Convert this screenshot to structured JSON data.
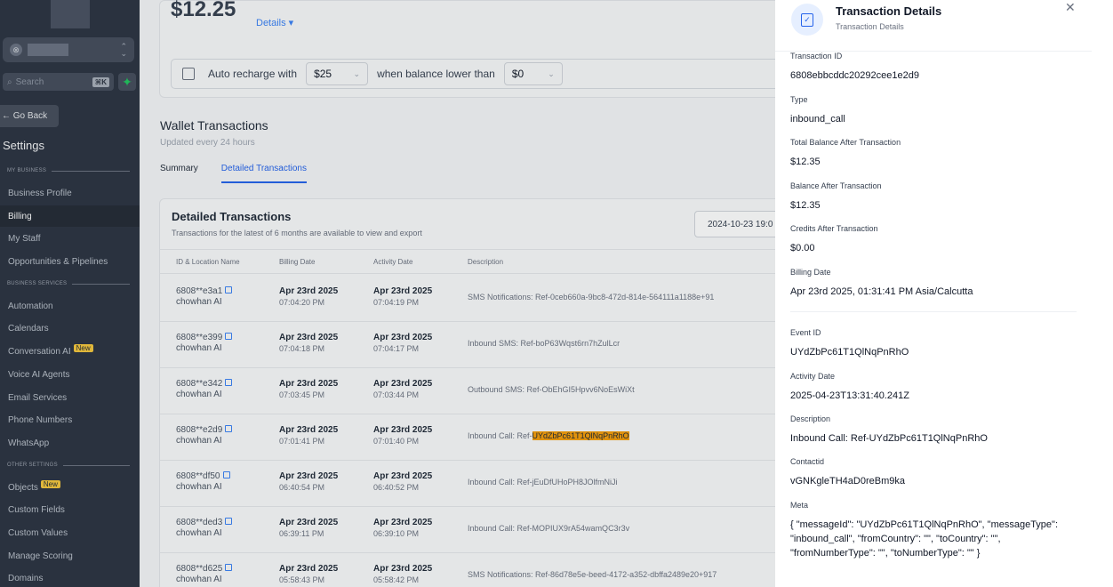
{
  "sidebar": {
    "search_placeholder": "Search",
    "search_kbd": "⌘K",
    "go_back": "← Go Back",
    "settings_title": "Settings",
    "section_my_business": "MY BUSINESS",
    "section_business_services": "BUSINESS SERVICES",
    "section_other_settings": "OTHER SETTINGS",
    "items": {
      "business_profile": "Business Profile",
      "billing": "Billing",
      "my_staff": "My Staff",
      "opportunities": "Opportunities & Pipelines",
      "automation": "Automation",
      "calendars": "Calendars",
      "conversation_ai": "Conversation AI",
      "voice_ai": "Voice AI Agents",
      "email_services": "Email Services",
      "phone_numbers": "Phone Numbers",
      "whatsapp": "WhatsApp",
      "objects": "Objects",
      "custom_fields": "Custom Fields",
      "custom_values": "Custom Values",
      "manage_scoring": "Manage Scoring",
      "domains": "Domains"
    },
    "new_badge": "New"
  },
  "wallet": {
    "balance": "$12.25",
    "details_link": "Details ▾",
    "recharge_prefix": "Auto recharge with",
    "recharge_amount": "$25",
    "recharge_mid": "when balance lower than",
    "threshold": "$0"
  },
  "transactions": {
    "title": "Wallet Transactions",
    "subtitle": "Updated every 24 hours",
    "tab_summary": "Summary",
    "tab_detailed": "Detailed Transactions"
  },
  "detailed": {
    "title": "Detailed Transactions",
    "subtitle": "Transactions for the latest of 6 months are available to view and export",
    "date_range": "2024-10-23 19:0",
    "columns": {
      "id": "ID & Location Name",
      "billing": "Billing Date",
      "activity": "Activity Date",
      "description": "Description"
    },
    "rows": [
      {
        "id": "6808**e3a1",
        "loc": "chowhan AI",
        "bill_date": "Apr 23rd 2025",
        "bill_time": "07:04:20 PM",
        "act_date": "Apr 23rd 2025",
        "act_time": "07:04:19 PM",
        "desc": "SMS Notifications: Ref-0ceb660a-9bc8-472d-814e-564111a1188e+91"
      },
      {
        "id": "6808**e399",
        "loc": "chowhan AI",
        "bill_date": "Apr 23rd 2025",
        "bill_time": "07:04:18 PM",
        "act_date": "Apr 23rd 2025",
        "act_time": "07:04:17 PM",
        "desc": "Inbound SMS: Ref-boP63Wqst6rn7hZulLcr"
      },
      {
        "id": "6808**e342",
        "loc": "chowhan AI",
        "bill_date": "Apr 23rd 2025",
        "bill_time": "07:03:45 PM",
        "act_date": "Apr 23rd 2025",
        "act_time": "07:03:44 PM",
        "desc": "Outbound SMS: Ref-ObEhGI5Hpvv6NoEsWiXt"
      },
      {
        "id": "6808**e2d9",
        "loc": "chowhan AI",
        "bill_date": "Apr 23rd 2025",
        "bill_time": "07:01:41 PM",
        "act_date": "Apr 23rd 2025",
        "act_time": "07:01:40 PM",
        "desc_prefix": "Inbound Call: Ref-",
        "desc_highlight": "UYdZbPc61T1QlNqPnRhO"
      },
      {
        "id": "6808**df50",
        "loc": "chowhan AI",
        "bill_date": "Apr 23rd 2025",
        "bill_time": "06:40:54 PM",
        "act_date": "Apr 23rd 2025",
        "act_time": "06:40:52 PM",
        "desc": "Inbound Call: Ref-jEuDfUHoPH8JOlfmNiJi"
      },
      {
        "id": "6808**ded3",
        "loc": "chowhan AI",
        "bill_date": "Apr 23rd 2025",
        "bill_time": "06:39:11 PM",
        "act_date": "Apr 23rd 2025",
        "act_time": "06:39:10 PM",
        "desc": "Inbound Call: Ref-MOPIUX9rA54wamQC3r3v"
      },
      {
        "id": "6808**d625",
        "loc": "chowhan AI",
        "bill_date": "Apr 23rd 2025",
        "bill_time": "05:58:43 PM",
        "act_date": "Apr 23rd 2025",
        "act_time": "05:58:42 PM",
        "desc": "SMS Notifications: Ref-86d78e5e-beed-4172-a352-dbffa2489e20+917"
      }
    ]
  },
  "panel": {
    "title": "Transaction Details",
    "subtitle": "Transaction Details",
    "close": "✕",
    "fields": {
      "transaction_id_label": "Transaction ID",
      "transaction_id": "6808ebbcddc20292cee1e2d9",
      "type_label": "Type",
      "type": "inbound_call",
      "total_balance_label": "Total Balance After Transaction",
      "total_balance": "$12.35",
      "balance_label": "Balance After Transaction",
      "balance": "$12.35",
      "credits_label": "Credits After Transaction",
      "credits": "$0.00",
      "billing_date_label": "Billing Date",
      "billing_date": "Apr 23rd 2025, 01:31:41 PM Asia/Calcutta",
      "event_id_label": "Event ID",
      "event_id": "UYdZbPc61T1QlNqPnRhO",
      "activity_date_label": "Activity Date",
      "activity_date": "2025-04-23T13:31:40.241Z",
      "description_label": "Description",
      "description": "Inbound Call: Ref-UYdZbPc61T1QlNqPnRhO",
      "contact_id_label": "Contactid",
      "contact_id": "vGNKgleTH4aD0reBm9ka",
      "meta_label": "Meta",
      "meta": "{ \"messageId\": \"UYdZbPc61T1QlNqPnRhO\", \"messageType\": \"inbound_call\", \"fromCountry\": \"\", \"toCountry\": \"\", \"fromNumberType\": \"\", \"toNumberType\": \"\" }"
    }
  }
}
